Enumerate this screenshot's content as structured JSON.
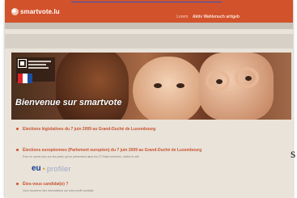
{
  "header": {
    "logo_text": "smartvote.lu",
    "link_small": "Lorem",
    "link_main": "Aktiv Wahlenuch artigeb"
  },
  "hero": {
    "headline": "Bienvenue sur smartvote"
  },
  "content": {
    "items": [
      {
        "title": "Elections législatives du 7 juin 2009 au Grand-Duché de Luxembourg"
      },
      {
        "title": "Élections européennes (Parlement européen) du 7 juin 2009 au Grand-Duché de Luxembourg",
        "description": "Pour en savoir plus sur les partis qui se présentent dans les 27 Etats membres, visitez le site"
      },
      {
        "title": "Êtes-vous candidat(e) ?",
        "description": "Vous trouverez des informations sur votre profil candidat"
      }
    ],
    "partner": {
      "eu": "eu",
      "dot": "•",
      "profiler": "profiler"
    }
  },
  "margin_text": "s",
  "colors": {
    "header": "#d2522c",
    "accent": "#c9532f",
    "page_bg": "#e9e3da"
  }
}
